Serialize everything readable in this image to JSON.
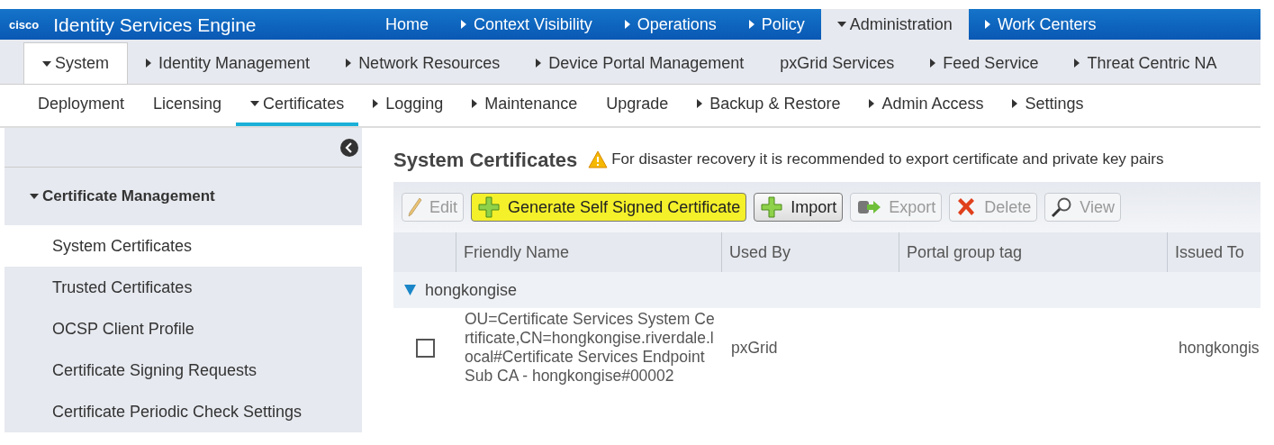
{
  "header": {
    "logo": "cisco",
    "title": "Identity Services Engine",
    "tabs": [
      {
        "label": "Home",
        "dropdown": false,
        "selected": false
      },
      {
        "label": "Context Visibility",
        "dropdown": true,
        "selected": false
      },
      {
        "label": "Operations",
        "dropdown": true,
        "selected": false
      },
      {
        "label": "Policy",
        "dropdown": true,
        "selected": false
      },
      {
        "label": "Administration",
        "dropdown": true,
        "selected": true
      },
      {
        "label": "Work Centers",
        "dropdown": true,
        "selected": false
      }
    ]
  },
  "subnav": [
    {
      "label": "System",
      "dropdown": true,
      "selected": true
    },
    {
      "label": "Identity Management",
      "dropdown": true,
      "selected": false
    },
    {
      "label": "Network Resources",
      "dropdown": true,
      "selected": false
    },
    {
      "label": "Device Portal Management",
      "dropdown": true,
      "selected": false
    },
    {
      "label": "pxGrid Services",
      "dropdown": false,
      "selected": false
    },
    {
      "label": "Feed Service",
      "dropdown": true,
      "selected": false
    },
    {
      "label": "Threat Centric NA",
      "dropdown": true,
      "selected": false
    }
  ],
  "thirdnav": [
    {
      "label": "Deployment",
      "dropdown": false,
      "selected": false
    },
    {
      "label": "Licensing",
      "dropdown": false,
      "selected": false
    },
    {
      "label": "Certificates",
      "dropdown": true,
      "selected": true
    },
    {
      "label": "Logging",
      "dropdown": true,
      "selected": false
    },
    {
      "label": "Maintenance",
      "dropdown": true,
      "selected": false
    },
    {
      "label": "Upgrade",
      "dropdown": false,
      "selected": false
    },
    {
      "label": "Backup & Restore",
      "dropdown": true,
      "selected": false
    },
    {
      "label": "Admin Access",
      "dropdown": true,
      "selected": false
    },
    {
      "label": "Settings",
      "dropdown": true,
      "selected": false
    }
  ],
  "sidebar": {
    "section": {
      "label": "Certificate Management",
      "expanded": true
    },
    "items": [
      {
        "label": "System Certificates",
        "selected": true
      },
      {
        "label": "Trusted Certificates",
        "selected": false
      },
      {
        "label": "OCSP Client Profile",
        "selected": false
      },
      {
        "label": "Certificate Signing Requests",
        "selected": false
      },
      {
        "label": "Certificate Periodic Check Settings",
        "selected": false
      }
    ]
  },
  "main": {
    "title": "System Certificates",
    "warning": "For disaster recovery it is recommended to export certificate and private key pairs",
    "toolbar": [
      {
        "kind": "edit",
        "label": "Edit",
        "disabled": true,
        "highlighted": false
      },
      {
        "kind": "add",
        "label": "Generate Self Signed Certificate",
        "disabled": false,
        "highlighted": true
      },
      {
        "kind": "add",
        "label": "Import",
        "disabled": false,
        "highlighted": false
      },
      {
        "kind": "export",
        "label": "Export",
        "disabled": true,
        "highlighted": false
      },
      {
        "kind": "delete",
        "label": "Delete",
        "disabled": true,
        "highlighted": false
      },
      {
        "kind": "view",
        "label": "View",
        "disabled": true,
        "highlighted": false
      }
    ],
    "table": {
      "columns": [
        "Friendly Name",
        "Used By",
        "Portal group tag",
        "Issued To"
      ],
      "groups": [
        {
          "label": "hongkongise",
          "expanded": true,
          "rows": [
            {
              "checked": false,
              "cells": [
                "OU=Certificate Services System Certificate,CN=hongkongise.riverdale.local#Certificate Services Endpoint Sub CA - hongkongise#00002",
                "pxGrid",
                "",
                "hongkongis"
              ]
            }
          ]
        }
      ]
    }
  }
}
